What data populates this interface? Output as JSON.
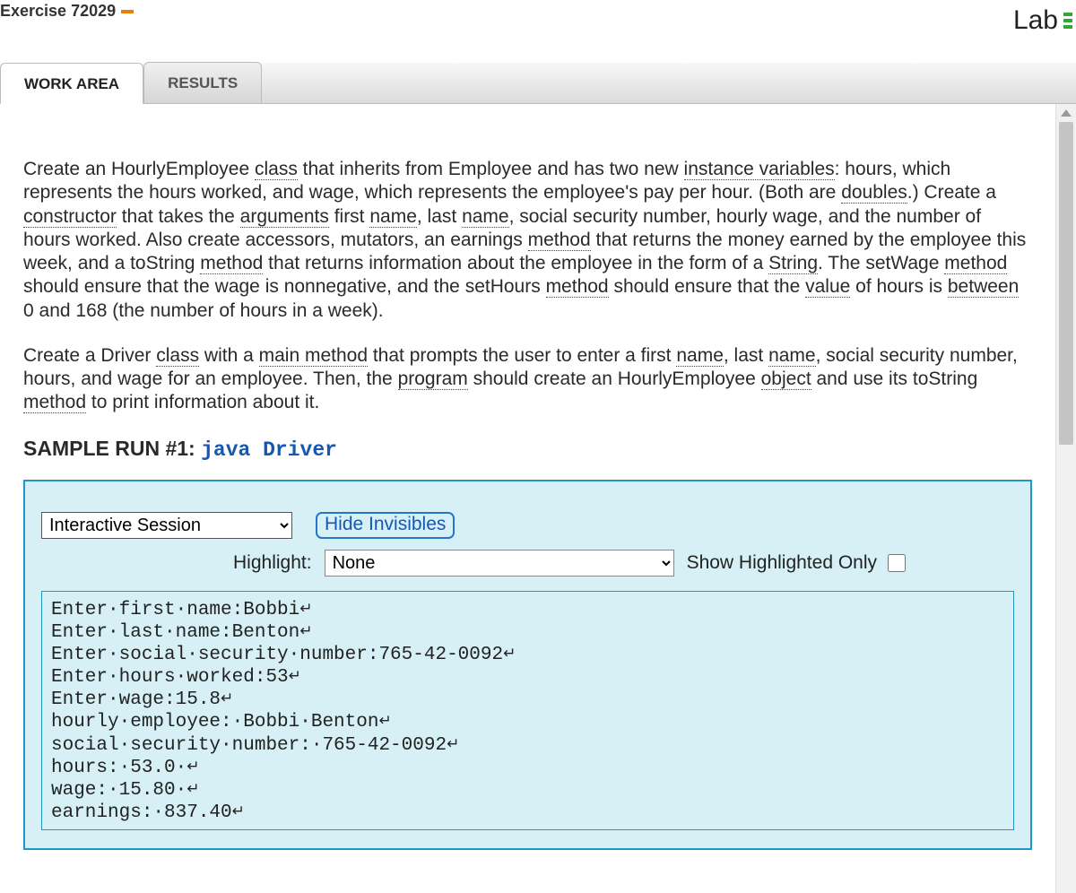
{
  "header": {
    "exercise_label": "Exercise 72029",
    "lab_label": "Lab"
  },
  "tabs": {
    "work_area": "WORK AREA",
    "results": "RESULTS"
  },
  "instructions": {
    "p1_pre1": "Create an HourlyEmployee ",
    "t_class": "class",
    "p1_pre2": " that inherits from Employee and has two new ",
    "t_ivars": "instance variables",
    "p1_seg3": ": hours, which represents the hours worked, and wage, which represents the employee's pay per hour. (Both are ",
    "t_doubles": "doubles",
    "p1_seg4": ".) Create a ",
    "t_constructor": "constructor",
    "p1_seg5": " that takes the ",
    "t_arguments": "arguments",
    "p1_seg6": " first ",
    "t_name1": "name",
    "p1_seg7": ", last ",
    "t_name2": "name",
    "p1_seg8": ", social security number, hourly wage, and the number of hours worked. Also create accessors, mutators, an earnings ",
    "t_method1": "method",
    "p1_seg9": " that returns the money earned by the employee this week, and a toString ",
    "t_method2": "method",
    "p1_seg10": " that returns information about the employee in the form of a ",
    "t_string": "String",
    "p1_seg11": ". The setWage ",
    "t_method3": "method",
    "p1_seg12": " should ensure that the wage is nonnegative, and the setHours ",
    "t_method4": "method",
    "p1_seg13": " should ensure that the ",
    "t_value": "value",
    "p1_seg14": " of hours is ",
    "t_between": "between",
    "p1_seg15": " 0 and 168 (the number of hours in a week).",
    "p2_seg1": "Create a Driver ",
    "t_class2": "class",
    "p2_seg2": " with a ",
    "t_mainmethod": "main method",
    "p2_seg3": " that prompts the user to enter a first ",
    "t_name3": "name",
    "p2_seg4": ", last ",
    "t_name4": "name",
    "p2_seg5": ", social security number, hours, and wage for an employee. Then, the ",
    "t_program": "program",
    "p2_seg6": " should create an HourlyEmployee ",
    "t_object": "object",
    "p2_seg7": " and use its toString ",
    "t_method5": "method",
    "p2_seg8": " to print information about it."
  },
  "sample_run": {
    "label": "SAMPLE RUN #1: ",
    "command": "java Driver"
  },
  "session": {
    "mode_selected": "Interactive Session",
    "hide_invisibles": "Hide Invisibles",
    "highlight_label": "Highlight:",
    "highlight_selected": "None",
    "show_highlighted_label": "Show Highlighted Only"
  },
  "terminal": {
    "lines": [
      "Enter·first·name:Bobbi↵",
      "Enter·last·name:Benton↵",
      "Enter·social·security·number:765-42-0092↵",
      "Enter·hours·worked:53↵",
      "Enter·wage:15.8↵",
      "hourly·employee:·Bobbi·Benton↵",
      "social·security·number:·765-42-0092↵",
      "hours:·53.0·↵",
      "wage:·15.80·↵",
      "earnings:·837.40↵"
    ]
  }
}
